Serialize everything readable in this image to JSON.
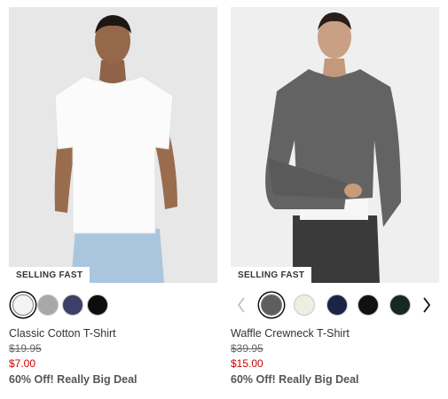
{
  "products": [
    {
      "badge": "SELLING FAST",
      "name": "Classic Cotton T-Shirt",
      "original_price": "$19.95",
      "sale_price": "$7.00",
      "promo": "60% Off! Really Big Deal",
      "swatches": [
        {
          "color": "#f4f4f4",
          "selected": true
        },
        {
          "color": "#a8a8a8",
          "selected": false
        },
        {
          "color": "#3d3f66",
          "selected": false
        },
        {
          "color": "#0d0d0d",
          "selected": false
        }
      ]
    },
    {
      "badge": "SELLING FAST",
      "name": "Waffle Crewneck T-Shirt",
      "original_price": "$39.95",
      "sale_price": "$15.00",
      "promo": "60% Off! Really Big Deal",
      "swatches": [
        {
          "color": "#5e5e5e",
          "selected": true
        },
        {
          "color": "#f0eee2",
          "selected": false
        },
        {
          "color": "#1c2344",
          "selected": false
        },
        {
          "color": "#111111",
          "selected": false
        },
        {
          "color": "#15291f",
          "selected": false
        }
      ],
      "carousel": {
        "prev_icon": "chevron-left-icon",
        "next_icon": "chevron-right-icon"
      }
    }
  ],
  "colors": {
    "sale": "#d00000",
    "badge_bg": "#ffffff"
  }
}
